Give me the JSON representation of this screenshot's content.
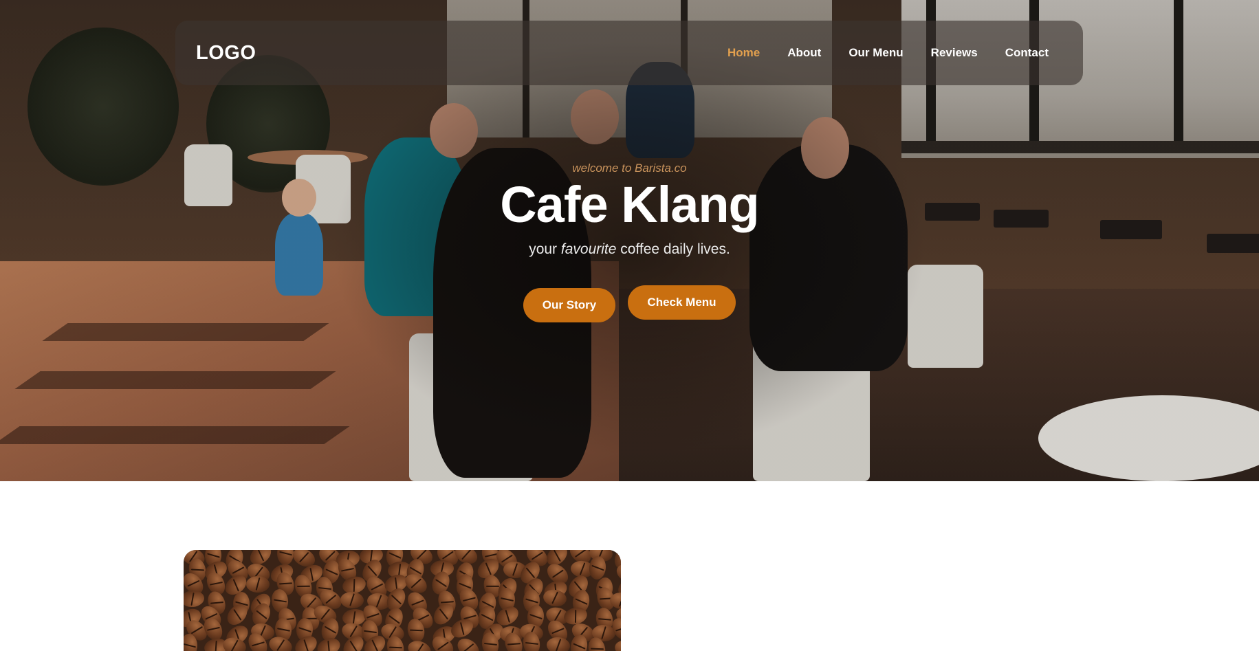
{
  "nav": {
    "logo": "LOGO",
    "links": [
      {
        "label": "Home",
        "active": true
      },
      {
        "label": "About",
        "active": false
      },
      {
        "label": "Our Menu",
        "active": false
      },
      {
        "label": "Reviews",
        "active": false
      },
      {
        "label": "Contact",
        "active": false
      }
    ]
  },
  "hero": {
    "welcome": "welcome to Barista.co",
    "title": "Cafe Klang",
    "tagline_before": "your ",
    "tagline_emphasis": "favourite",
    "tagline_after": " coffee daily lives.",
    "buttons": {
      "story": "Our Story",
      "menu": "Check Menu"
    }
  },
  "colors": {
    "accent": "#c96f10",
    "nav_active": "#e2a04e",
    "welcome_text": "#c9935c"
  },
  "images": {
    "hero_background": "cafe interior with people seated at table",
    "section_image": "coffee beans"
  }
}
